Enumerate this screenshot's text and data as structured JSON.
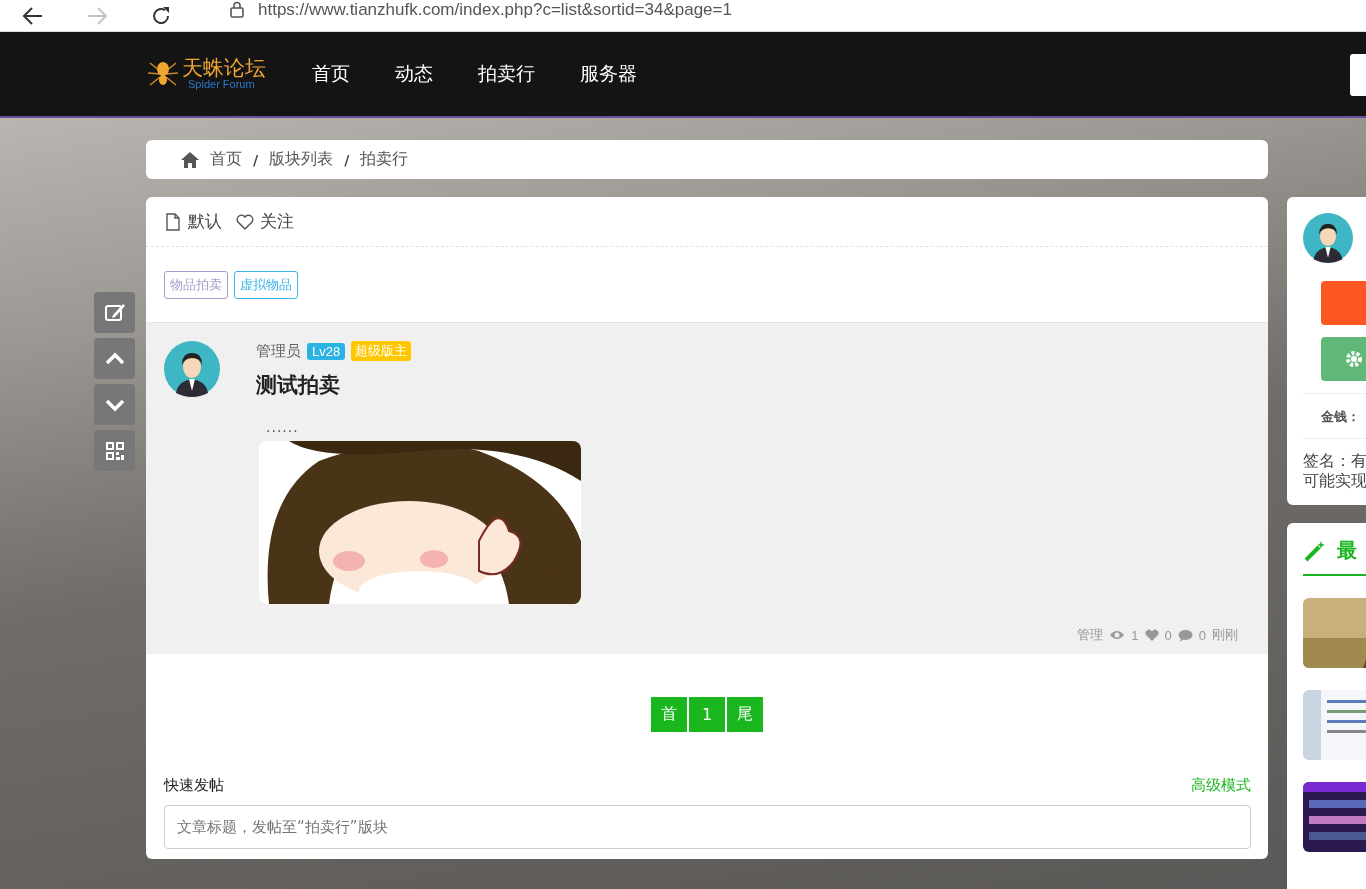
{
  "browser": {
    "url": "https://www.tianzhufk.com/index.php?c=list&sortid=34&page=1",
    "forward_disabled": true
  },
  "nav": {
    "logo_title": "天蛛论坛",
    "logo_subtitle": "Spider Forum",
    "items": [
      {
        "label": "首页"
      },
      {
        "label": "动态"
      },
      {
        "label": "拍卖行"
      },
      {
        "label": "服务器"
      }
    ]
  },
  "breadcrumb": [
    {
      "kind": "link",
      "label": "首页"
    },
    {
      "kind": "separator",
      "label": "/"
    },
    {
      "kind": "link",
      "label": "版块列表"
    },
    {
      "kind": "separator",
      "label": "/"
    },
    {
      "kind": "link",
      "label": "拍卖行"
    }
  ],
  "sort_tabs": [
    {
      "label": "默认",
      "kind": "file"
    },
    {
      "label": "关注",
      "kind": "heart"
    }
  ],
  "tags": [
    {
      "label": "物品拍卖",
      "color": "#a99bd0"
    },
    {
      "label": "虚拟物品",
      "color": "#3ab4ea"
    }
  ],
  "post": {
    "author": "管理员",
    "level": "Lv28",
    "role": "超级版主",
    "title": "测试拍卖",
    "excerpt": "......",
    "image": {
      "kind": "picture"
    },
    "footer": {
      "author": "管理",
      "views": "1",
      "likes": "0",
      "comments": "0",
      "time": "刚刚"
    }
  },
  "pagination": [
    "首",
    "1",
    "尾"
  ],
  "quick_post": {
    "title": "快速发帖",
    "advanced_link": "高级模式",
    "placeholder": "文章标题，发帖至“拍卖行”版块"
  },
  "sidebar": {
    "money_label": "金钱：",
    "signature": [
      "签名：有",
      "可能实现"
    ],
    "latest_title": "最",
    "thumbnails": [
      {
        "kind": "picture"
      },
      {
        "kind": "picture"
      },
      {
        "kind": "picture"
      }
    ]
  }
}
